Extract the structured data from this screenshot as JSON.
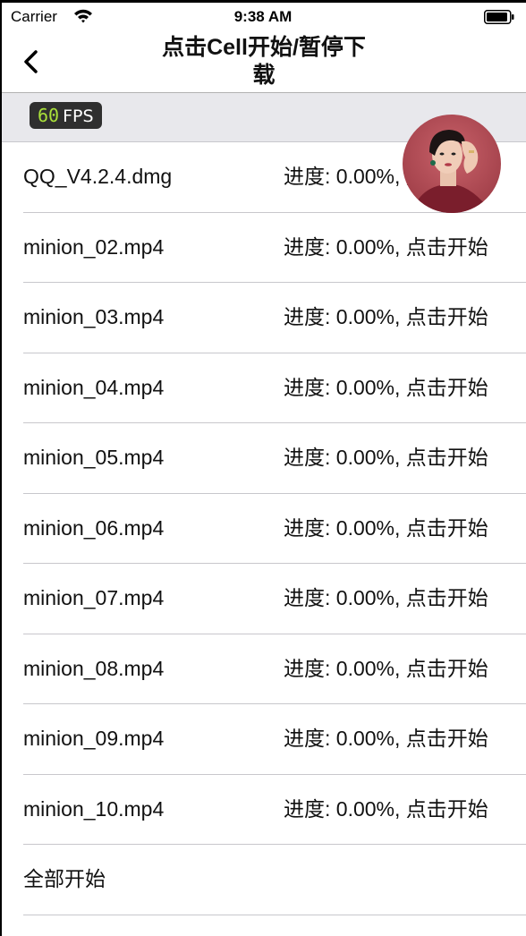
{
  "status_bar": {
    "carrier": "Carrier",
    "time": "9:38 AM"
  },
  "nav": {
    "title": "点击Cell开始/暂停下载"
  },
  "fps": {
    "value": "60",
    "unit": "FPS"
  },
  "rows": [
    {
      "name": "QQ_V4.2.4.dmg",
      "progress": "进度: 0.00%, 点击开始"
    },
    {
      "name": "minion_02.mp4",
      "progress": "进度: 0.00%, 点击开始"
    },
    {
      "name": "minion_03.mp4",
      "progress": "进度: 0.00%, 点击开始"
    },
    {
      "name": "minion_04.mp4",
      "progress": "进度: 0.00%, 点击开始"
    },
    {
      "name": "minion_05.mp4",
      "progress": "进度: 0.00%, 点击开始"
    },
    {
      "name": "minion_06.mp4",
      "progress": "进度: 0.00%, 点击开始"
    },
    {
      "name": "minion_07.mp4",
      "progress": "进度: 0.00%, 点击开始"
    },
    {
      "name": "minion_08.mp4",
      "progress": "进度: 0.00%, 点击开始"
    },
    {
      "name": "minion_09.mp4",
      "progress": "进度: 0.00%, 点击开始"
    },
    {
      "name": "minion_10.mp4",
      "progress": "进度: 0.00%, 点击开始"
    },
    {
      "name": "全部开始",
      "progress": ""
    }
  ],
  "icons": {
    "back": "chevron-left-icon",
    "wifi": "wifi-icon",
    "battery": "battery-icon",
    "avatar": "avatar-photo"
  },
  "colors": {
    "fps_value": "#a9e03a",
    "fps_badge_bg": "#2f2f2f",
    "fps_bar_bg": "#e8e8ec",
    "separator": "#c8c7cc",
    "avatar_bg": "#b4464f"
  }
}
